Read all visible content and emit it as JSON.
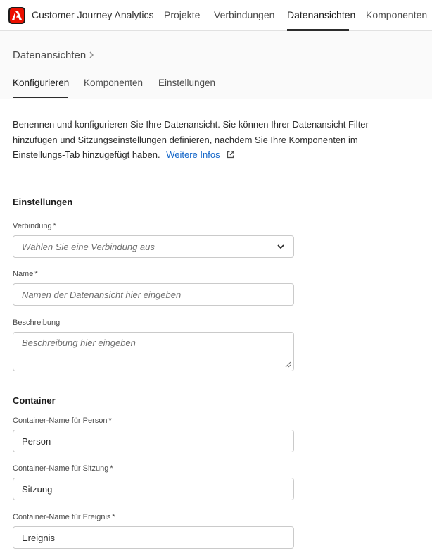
{
  "app": {
    "title": "Customer Journey Analytics"
  },
  "nav": {
    "items": [
      {
        "label": "Projekte",
        "active": false
      },
      {
        "label": "Verbindungen",
        "active": false
      },
      {
        "label": "Datenansichten",
        "active": true
      },
      {
        "label": "Komponenten",
        "active": false
      }
    ]
  },
  "breadcrumb": {
    "label": "Datenansichten"
  },
  "tabs": [
    {
      "label": "Konfigurieren",
      "active": true
    },
    {
      "label": "Komponenten",
      "active": false
    },
    {
      "label": "Einstellungen",
      "active": false
    }
  ],
  "intro": {
    "text": "Benennen und konfigurieren Sie Ihre Datenansicht. Sie können Ihrer Datenansicht Filter hinzufügen und Sitzungseinstellungen definieren, nachdem Sie Ihre Komponenten im Einstellungs-Tab hinzugefügt haben.",
    "link_label": "Weitere Infos"
  },
  "settings": {
    "heading": "Einstellungen",
    "connection": {
      "label": "Verbindung",
      "required_mark": "*",
      "placeholder": "Wählen Sie eine Verbindung aus"
    },
    "name": {
      "label": "Name",
      "required_mark": "*",
      "placeholder": "Namen der Datenansicht hier eingeben",
      "value": ""
    },
    "description": {
      "label": "Beschreibung",
      "placeholder": "Beschreibung hier eingeben",
      "value": ""
    }
  },
  "container": {
    "heading": "Container",
    "person": {
      "label": "Container-Name für Person",
      "required_mark": "*",
      "value": "Person"
    },
    "session": {
      "label": "Container-Name für Sitzung",
      "required_mark": "*",
      "value": "Sitzung"
    },
    "event": {
      "label": "Container-Name für Ereignis",
      "required_mark": "*",
      "value": "Ereignis"
    }
  },
  "colors": {
    "brand": "#eb1000",
    "link": "#1265c8",
    "text": "#2c2c2c",
    "border": "#cacaca"
  },
  "icons": [
    "adobe-logo-icon",
    "chevron-right-icon",
    "external-link-icon",
    "chevron-down-icon",
    "resize-grip-icon"
  ]
}
